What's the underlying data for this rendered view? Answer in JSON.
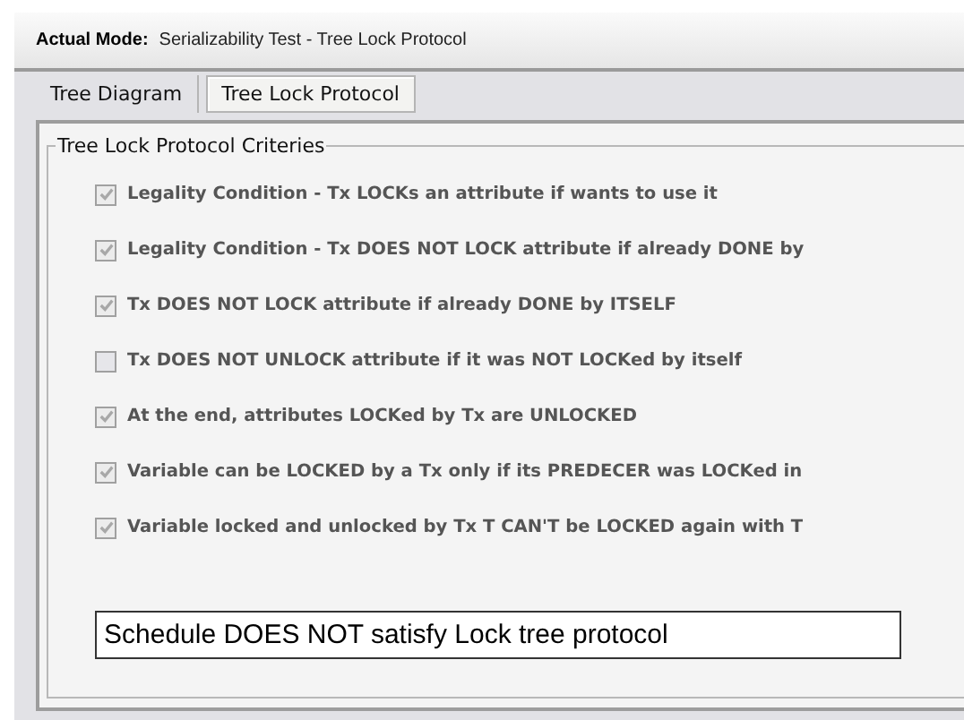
{
  "header": {
    "label": "Actual Mode:",
    "value": "Serializability Test - Tree Lock Protocol"
  },
  "tabs": [
    {
      "label": "Tree Diagram",
      "selected": false
    },
    {
      "label": "Tree Lock Protocol",
      "selected": true
    }
  ],
  "group": {
    "title": "Tree Lock Protocol Criteries",
    "criteria": [
      {
        "label": "Legality Condition - Tx LOCKs an attribute if wants to use it",
        "checked": true
      },
      {
        "label": "Legality Condition - Tx DOES NOT LOCK attribute if already DONE by",
        "checked": true
      },
      {
        "label": "Tx DOES NOT LOCK attribute if already DONE by ITSELF",
        "checked": true
      },
      {
        "label": "Tx DOES NOT UNLOCK attribute if it was NOT LOCKed by itself",
        "checked": false
      },
      {
        "label": "At the end, attributes LOCKed by Tx are UNLOCKED",
        "checked": true
      },
      {
        "label": "Variable can be LOCKED by a Tx only if its PREDECER was LOCKed in",
        "checked": true
      },
      {
        "label": "Variable locked and unlocked by Tx T CAN'T be LOCKED again with T",
        "checked": true
      }
    ],
    "result": "Schedule DOES NOT satisfy Lock tree protocol"
  }
}
